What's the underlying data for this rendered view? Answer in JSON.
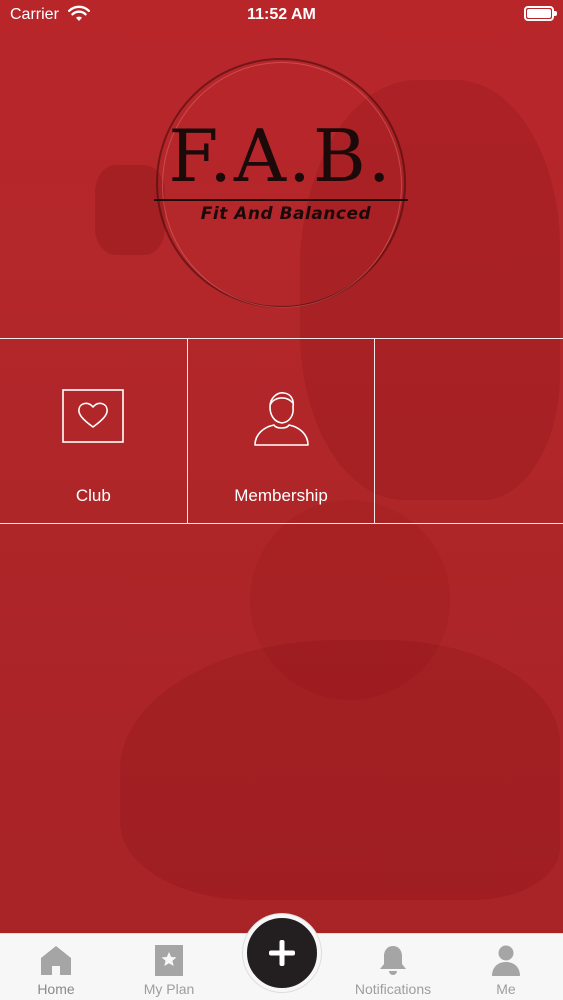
{
  "status_bar": {
    "carrier": "Carrier",
    "time": "11:52 AM"
  },
  "logo": {
    "title": "F.A.B.",
    "subtitle": "Fit And Balanced"
  },
  "tiles": [
    {
      "label": "Club",
      "icon": "heart-icon"
    },
    {
      "label": "Membership",
      "icon": "person-icon"
    },
    {
      "label": "",
      "icon": ""
    }
  ],
  "tab_bar": {
    "items": [
      {
        "label": "Home",
        "icon": "home-icon"
      },
      {
        "label": "My Plan",
        "icon": "star-icon"
      },
      {
        "label": "Notifications",
        "icon": "bell-icon"
      },
      {
        "label": "Me",
        "icon": "user-icon"
      }
    ],
    "center_button_icon": "plus-icon"
  },
  "colors": {
    "background": "#b3272a",
    "tab_bar": "#f7f7f7",
    "tab_icon": "#a5a5a5",
    "center_button": "#231f20",
    "logo_ink": "#1c0a0b"
  }
}
